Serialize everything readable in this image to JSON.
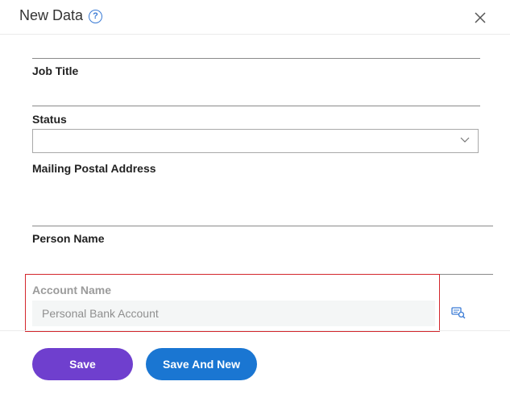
{
  "dialog": {
    "title": "New Data",
    "help_icon": "?",
    "close_icon": "close-icon"
  },
  "fields": {
    "job_title": "Job Title",
    "status": {
      "label": "Status",
      "value": ""
    },
    "mailing_postal_address": "Mailing Postal Address",
    "person_name": "Person Name",
    "account_name": {
      "label": "Account Name",
      "value": "Personal Bank Account"
    }
  },
  "buttons": {
    "save": "Save",
    "save_and_new": "Save And New"
  },
  "colors": {
    "highlight": "#d3262c",
    "save_button": "#6f3fce",
    "save_new_button": "#1a76d2",
    "help_icon": "#3a7bd5"
  }
}
